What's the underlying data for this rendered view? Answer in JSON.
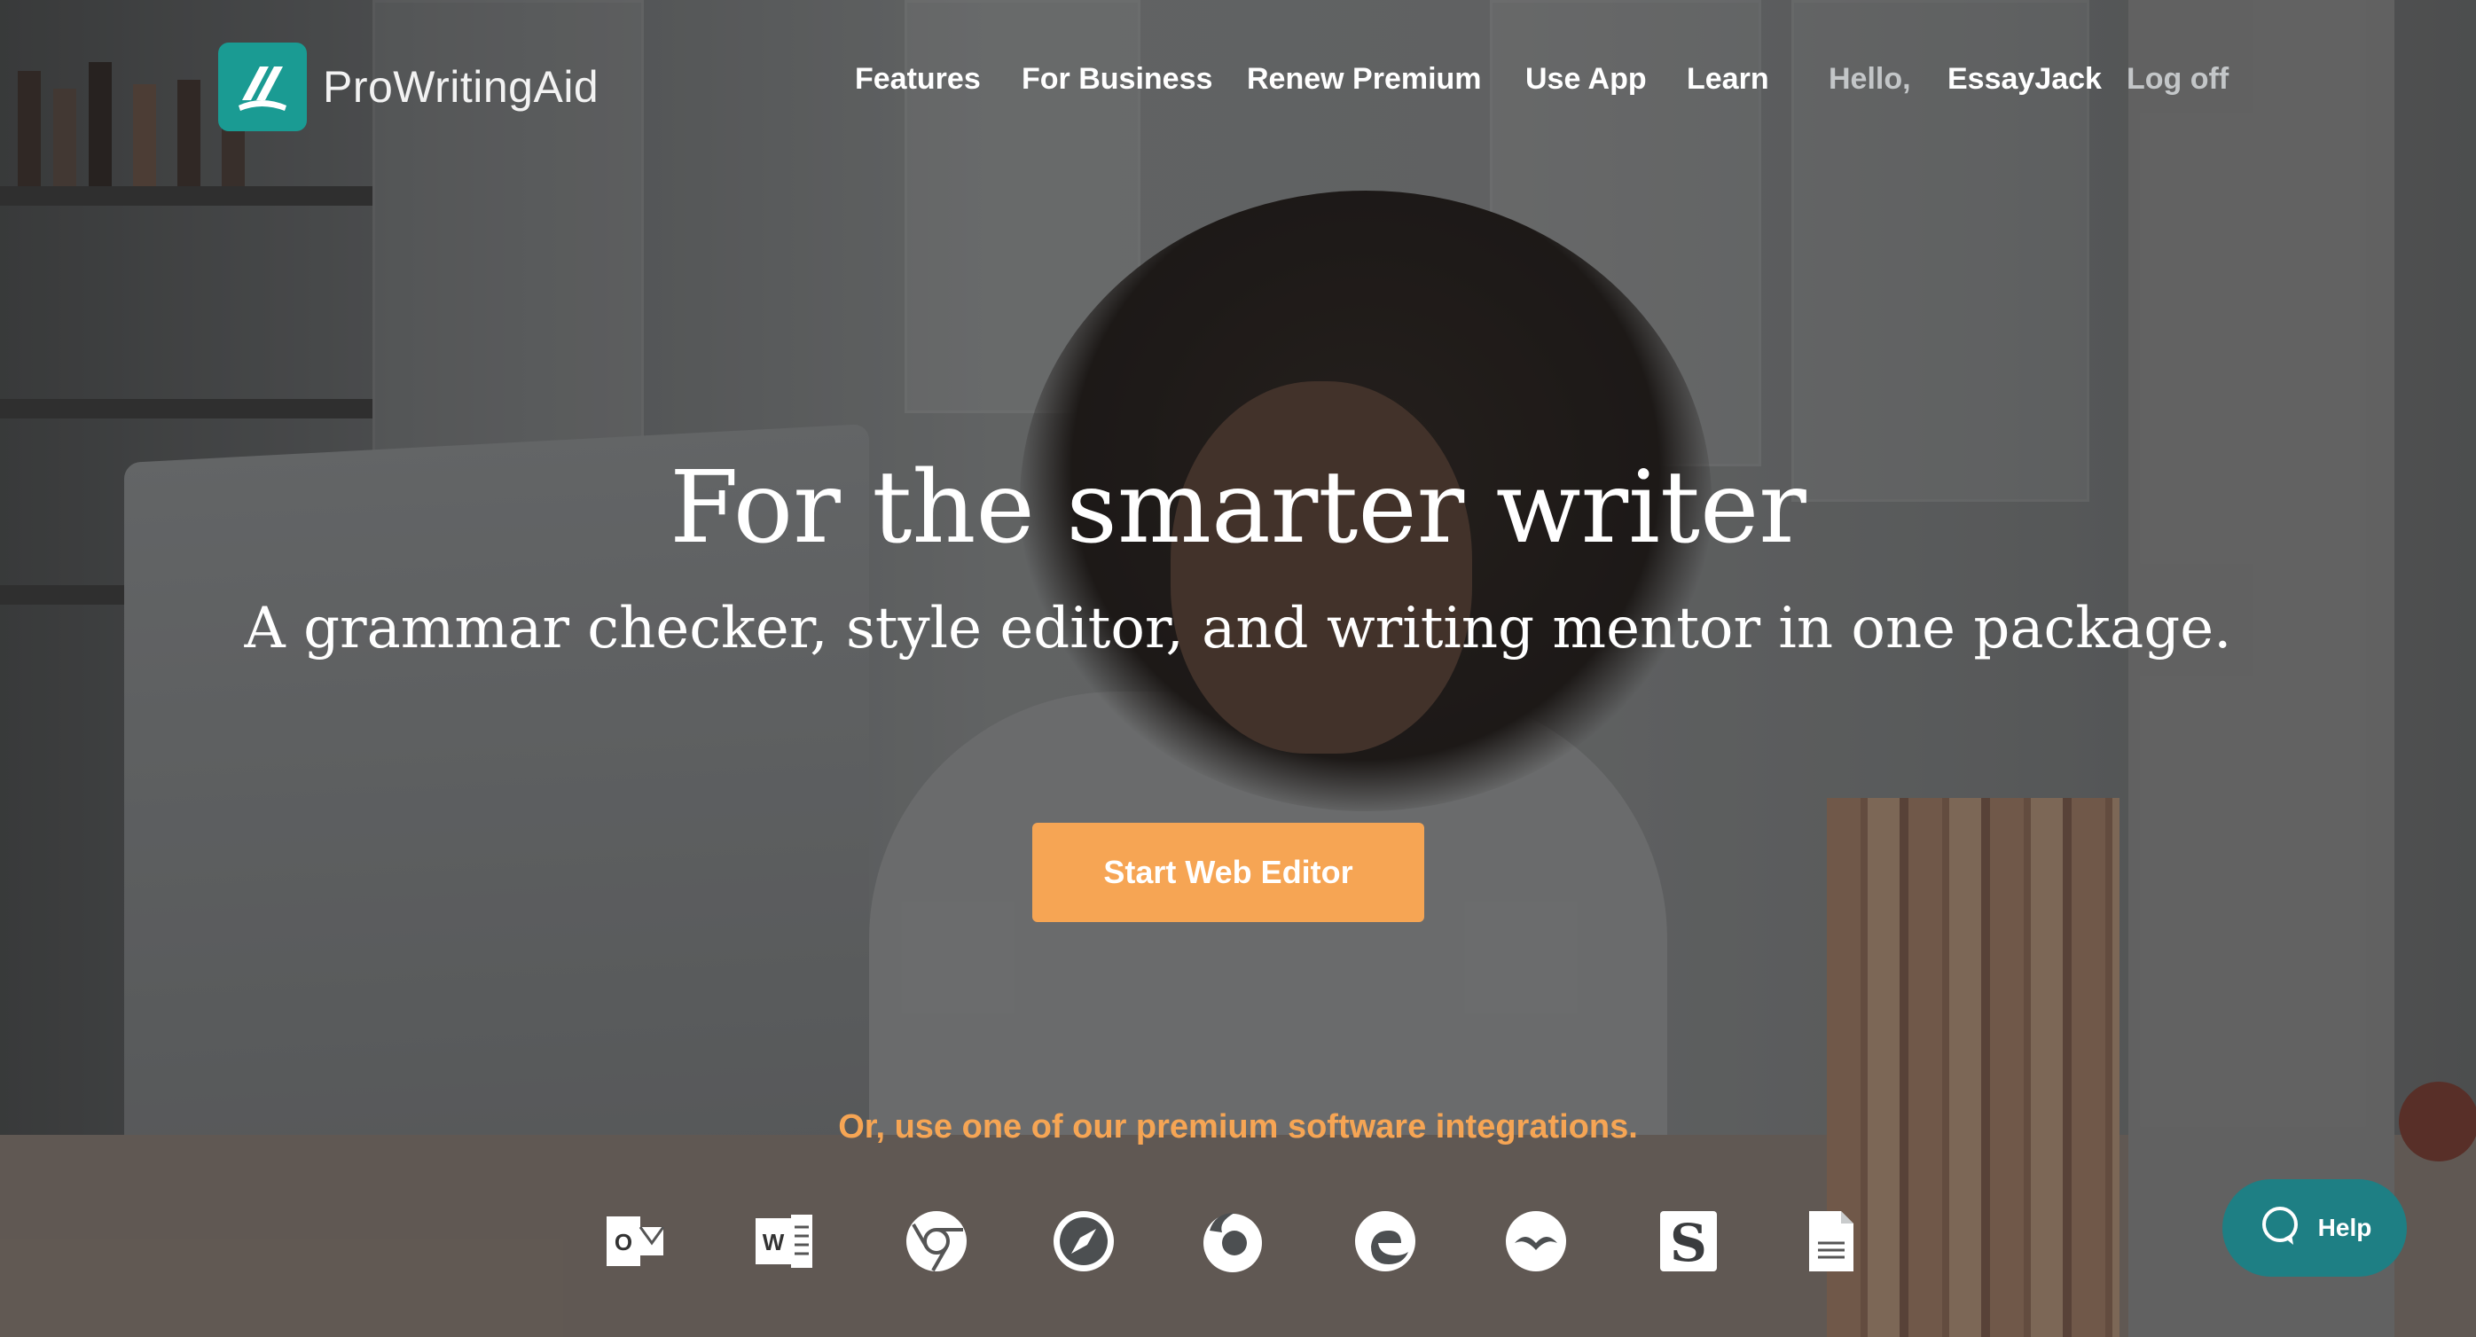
{
  "brand": {
    "name": "ProWritingAid",
    "accent_color": "#1a9b93"
  },
  "nav": {
    "features": "Features",
    "for_business": "For Business",
    "renew_premium": "Renew Premium",
    "use_app": "Use App",
    "learn": "Learn",
    "greeting": "Hello,",
    "username": "EssayJack",
    "log_off": "Log off"
  },
  "hero": {
    "title": "For the smarter writer",
    "subtitle": "A grammar checker, style editor, and writing mentor in one package.",
    "cta_label": "Start Web Editor",
    "cta_color": "#f6a554"
  },
  "integrations": {
    "label": "Or, use one of our premium software integrations.",
    "icons": [
      "outlook-icon",
      "word-icon",
      "chrome-icon",
      "safari-icon",
      "firefox-icon",
      "edge-icon",
      "openoffice-icon",
      "scrivener-icon",
      "google-docs-icon"
    ]
  },
  "help": {
    "label": "Help",
    "color": "#1e7f84"
  }
}
